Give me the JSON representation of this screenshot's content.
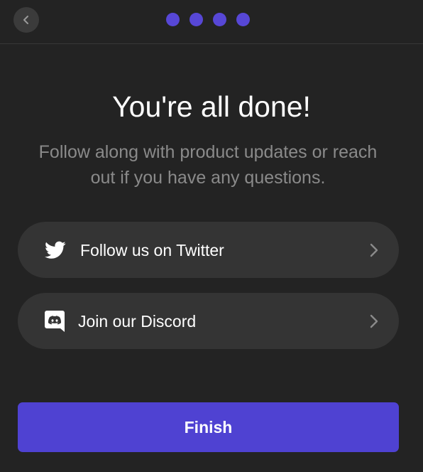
{
  "header": {
    "back_icon": "chevron-left-icon",
    "steps_total": 4,
    "dot_color": "#5747d6"
  },
  "main": {
    "title": "You're all done!",
    "subtitle": "Follow along with product updates or reach out if you have any questions."
  },
  "links": [
    {
      "icon": "twitter-icon",
      "label": "Follow us on Twitter",
      "trailing_icon": "chevron-right-icon"
    },
    {
      "icon": "discord-icon",
      "label": "Join our Discord",
      "trailing_icon": "chevron-right-icon"
    }
  ],
  "footer": {
    "finish_label": "Finish",
    "accent_color": "#4f42d2"
  }
}
